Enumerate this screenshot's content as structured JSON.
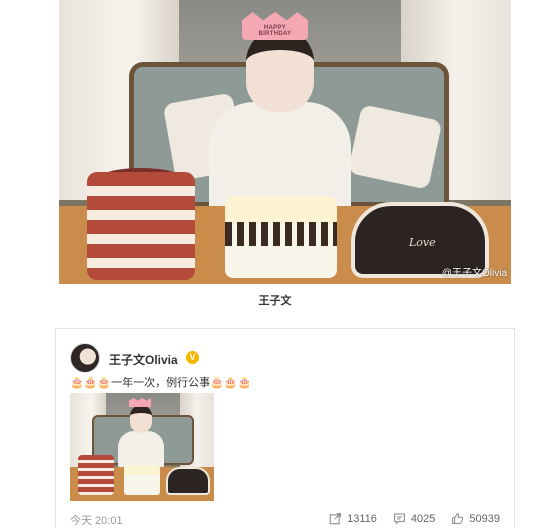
{
  "hero": {
    "crown_text": "HAPPY BIRTHDAY",
    "cake_text": "Love",
    "watermark": "@王子文Olivia",
    "caption": "王子文"
  },
  "post": {
    "username": "王子文Olivia",
    "verified_badge": "V",
    "text": "🎂🎂🎂一年一次，例行公事🎂🎂🎂",
    "time": "今天 20:01",
    "reposts": "13116",
    "comments": "4025",
    "likes": "50939"
  },
  "icons": {
    "verified": "verified-badge-icon",
    "repost": "share-icon",
    "comment": "comment-icon",
    "like": "thumbs-up-icon"
  },
  "colors": {
    "verified": "#f7b500",
    "muted": "#999999"
  }
}
